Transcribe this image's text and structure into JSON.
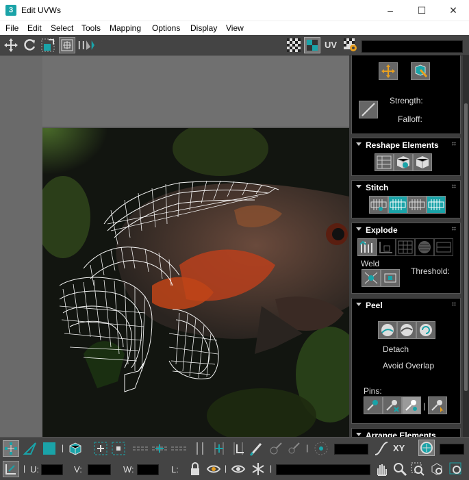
{
  "window": {
    "title": "Edit UVWs",
    "app_icon_glyph": "3",
    "minimize_glyph": "–",
    "maximize_glyph": "☐",
    "close_glyph": "✕"
  },
  "menu": [
    "File",
    "Edit",
    "Select",
    "Tools",
    "Mapping",
    "Options",
    "Display",
    "View"
  ],
  "toolbar": {
    "uv_label": "UV"
  },
  "panel": {
    "soft": {
      "strength_label": "Strength:",
      "falloff_label": "Falloff:"
    },
    "reshape": {
      "title": "Reshape Elements"
    },
    "stitch": {
      "title": "Stitch"
    },
    "explode": {
      "title": "Explode",
      "weld_label": "Weld",
      "threshold_label": "Threshold:"
    },
    "peel": {
      "title": "Peel",
      "detach_label": "Detach",
      "avoid_overlap_label": "Avoid Overlap",
      "pins_label": "Pins:"
    },
    "arrange": {
      "title": "Arrange Elements"
    }
  },
  "bottom": {
    "xy_label": "XY",
    "u_label": "U:",
    "v_label": "V:",
    "w_label": "W:",
    "l_label": "L:"
  },
  "colors": {
    "accent": "#1aa3a8",
    "uv_wire": "#ffffff",
    "panel_bg": "#3d3d3d",
    "rollout_bg": "#000000"
  }
}
